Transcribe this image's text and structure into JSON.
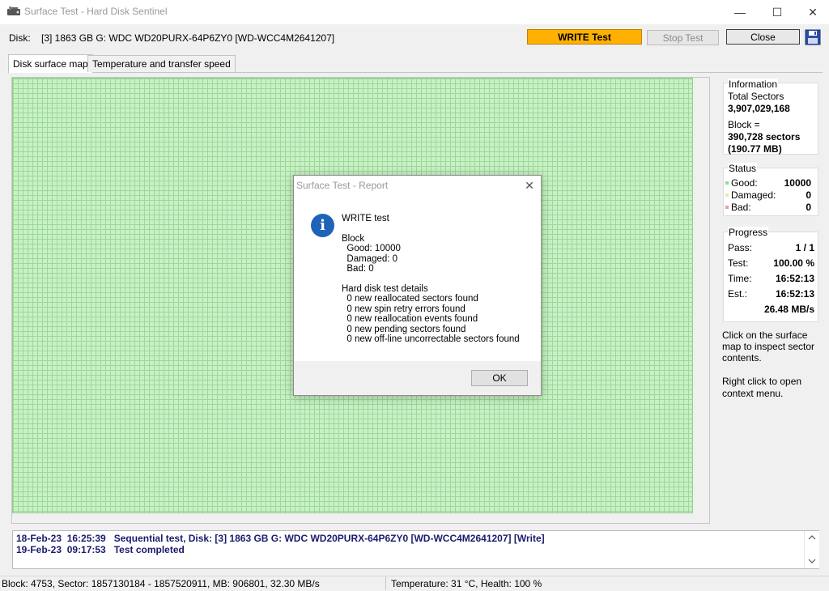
{
  "window": {
    "title": "Surface Test - Hard Disk Sentinel",
    "minimize": "—",
    "maximize": "☐",
    "close": "✕"
  },
  "toolbar": {
    "disk_label": "Disk:",
    "disk_name": "[3] 1863 GB G: WDC WD20PURX-64P6ZY0 [WD-WCC4M2641207]",
    "write_test": "WRITE Test",
    "stop_test": "Stop Test",
    "close": "Close"
  },
  "tabs": [
    "Disk surface map",
    "Temperature and transfer speed"
  ],
  "info": {
    "title": "Information",
    "total_sectors_label": "Total Sectors",
    "total_sectors": "3,907,029,168",
    "block_label": "Block =",
    "block_sectors": "390,728 sectors",
    "block_size": "(190.77 MB)"
  },
  "status": {
    "title": "Status",
    "good_label": "Good:",
    "good": "10000",
    "damaged_label": "Damaged:",
    "damaged": "0",
    "bad_label": "Bad:",
    "bad": "0",
    "good_color": "#8fe08f",
    "damaged_color": "#e7e7b0",
    "bad_color": "#e8a0a0"
  },
  "progress": {
    "title": "Progress",
    "pass_label": "Pass:",
    "pass": "1 / 1",
    "test_label": "Test:",
    "test": "100.00 %",
    "time_label": "Time:",
    "time": "16:52:13",
    "est_label": "Est.:",
    "est": "16:52:13",
    "speed": "26.48 MB/s"
  },
  "hints": {
    "click_1": "Click on the surface",
    "click_2": "map to inspect sector",
    "click_3": "contents.",
    "right_1": "Right click to open",
    "right_2": "context menu."
  },
  "log": [
    "18-Feb-23  16:25:39   Sequential test, Disk: [3] 1863 GB G: WDC WD20PURX-64P6ZY0 [WD-WCC4M2641207] [Write]",
    "19-Feb-23  09:17:53   Test completed"
  ],
  "statusbar": {
    "left": "Block: 4753, Sector: 1857130184 - 1857520911, MB: 906801, 32.30 MB/s",
    "right": "Temperature: 31  °C,  Health: 100 %"
  },
  "dialog": {
    "title": "Surface Test - Report",
    "icon": "i",
    "heading": "WRITE test",
    "block_label": "Block",
    "good": "  Good: 10000",
    "damaged": "  Damaged: 0",
    "bad": "  Bad: 0",
    "details_label": "Hard disk test details",
    "d1": "  0 new reallocated sectors found",
    "d2": "  0 new spin retry errors found",
    "d3": "  0 new reallocation events found",
    "d4": "  0 new pending sectors found",
    "d5": "  0 new off-line uncorrectable sectors found",
    "ok": "OK"
  },
  "colors": {
    "write_button": "#ffb000",
    "surface_good": "#c9f1c5",
    "log_text": "#1a1a6e",
    "info_icon": "#1f63b8"
  }
}
